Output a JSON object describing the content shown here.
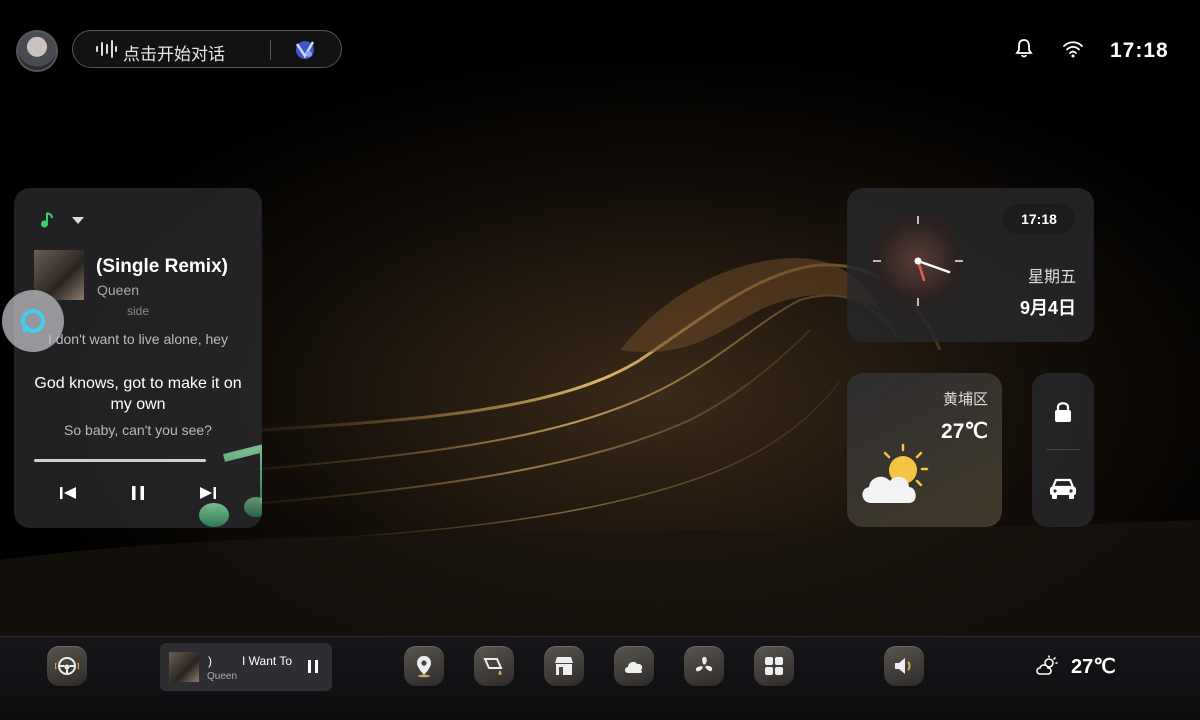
{
  "topbar": {
    "voice_prompt": "点击开始对话",
    "time": "17:18"
  },
  "music_card": {
    "title": "(Single Remix)",
    "artist": "Queen",
    "lyrics": {
      "prev_partial": "side",
      "prev": "I don't want to live alone, hey",
      "current": "God knows, got to make it on my own",
      "next": "So baby, can't you see?"
    },
    "progress": 0.86
  },
  "clock_card": {
    "time": "17:18",
    "weekday": "星期五",
    "date": "9月4日"
  },
  "weather_card": {
    "district": "黄埔区",
    "temperature": "27℃",
    "icon": "partly-cloudy-icon"
  },
  "control_card": {
    "icons": [
      "lock-icon",
      "car-icon"
    ]
  },
  "dock": {
    "mini_player": {
      "title_fragment": ")",
      "title": "I Want To",
      "artist": "Queen"
    },
    "apps": [
      "steering-wheel-icon",
      "navigation-icon",
      "car-paint-icon",
      "store-icon",
      "cloud-icon",
      "fan-icon",
      "apps-grid-icon",
      "volume-icon"
    ],
    "temperature": "27℃"
  },
  "colors": {
    "accent_gold": "#d9a85a",
    "music_green": "#3ccf6e",
    "sun_yellow": "#f6c443"
  }
}
